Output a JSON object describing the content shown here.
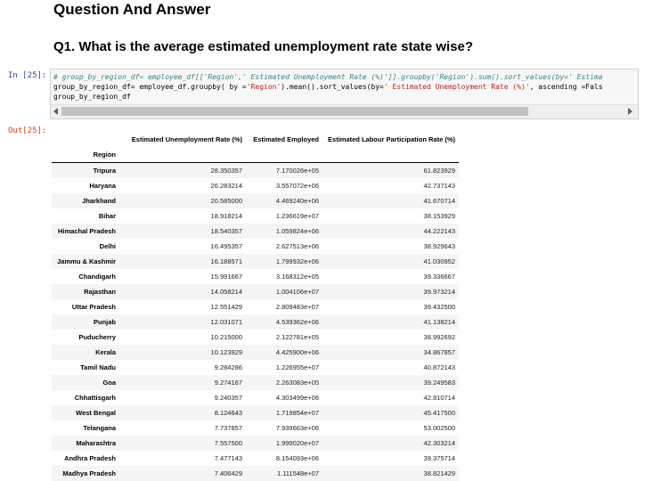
{
  "heading": "Question And Answer",
  "question": "Q1. What is the average estimated unemployment rate state wise?",
  "input_prompt": "In [25]:",
  "output_prompt": "Out[25]:",
  "code": {
    "line1": "# group_by_region_df= employee_df[['Region',' Estimated Unemployment Rate (%)']].groupby('Region').sum().sort_values(by=' Estima",
    "line2_pre": "group_by_region_df= employee_df.groupby( by =",
    "line2_s1": "'Region'",
    "line2_mid": ").mean().sort_values(by=",
    "line2_s2": "' Estimated Unemployment Rate (%)'",
    "line2_post": ", ascending =Fals",
    "line3": "group_by_region_df"
  },
  "table": {
    "columns": [
      "Estimated Unemployment Rate (%)",
      "Estimated Employed",
      "Estimated Labour Participation Rate (%)"
    ],
    "index_name": "Region",
    "rows": [
      {
        "region": "Tripura",
        "unemp": "28.350357",
        "employed": "7.170026e+05",
        "labour": "61.823929"
      },
      {
        "region": "Haryana",
        "unemp": "26.283214",
        "employed": "3.557072e+06",
        "labour": "42.737143"
      },
      {
        "region": "Jharkhand",
        "unemp": "20.585000",
        "employed": "4.469240e+06",
        "labour": "41.670714"
      },
      {
        "region": "Bihar",
        "unemp": "18.918214",
        "employed": "1.236619e+07",
        "labour": "38.153929"
      },
      {
        "region": "Himachal Pradesh",
        "unemp": "18.540357",
        "employed": "1.059824e+06",
        "labour": "44.222143"
      },
      {
        "region": "Delhi",
        "unemp": "16.495357",
        "employed": "2.627513e+06",
        "labour": "38.929643"
      },
      {
        "region": "Jammu & Kashmir",
        "unemp": "16.188571",
        "employed": "1.799932e+06",
        "labour": "41.030952"
      },
      {
        "region": "Chandigarh",
        "unemp": "15.991667",
        "employed": "3.168312e+05",
        "labour": "39.336667"
      },
      {
        "region": "Rajasthan",
        "unemp": "14.058214",
        "employed": "1.004106e+07",
        "labour": "39.973214"
      },
      {
        "region": "Uttar Pradesh",
        "unemp": "12.551429",
        "employed": "2.809483e+07",
        "labour": "39.432500"
      },
      {
        "region": "Punjab",
        "unemp": "12.031071",
        "employed": "4.539362e+06",
        "labour": "41.138214"
      },
      {
        "region": "Puducherry",
        "unemp": "10.215000",
        "employed": "2.122781e+05",
        "labour": "38.992692"
      },
      {
        "region": "Kerala",
        "unemp": "10.123929",
        "employed": "4.425900e+06",
        "labour": "34.867857"
      },
      {
        "region": "Tamil Nadu",
        "unemp": "9.284286",
        "employed": "1.226955e+07",
        "labour": "40.872143"
      },
      {
        "region": "Goa",
        "unemp": "9.274167",
        "employed": "2.263083e+05",
        "labour": "39.249583"
      },
      {
        "region": "Chhattisgarh",
        "unemp": "9.240357",
        "employed": "4.303499e+06",
        "labour": "42.810714"
      },
      {
        "region": "West Bengal",
        "unemp": "8.124643",
        "employed": "1.719854e+07",
        "labour": "45.417500"
      },
      {
        "region": "Telangana",
        "unemp": "7.737857",
        "employed": "7.939663e+06",
        "labour": "53.002500"
      },
      {
        "region": "Maharashtra",
        "unemp": "7.557500",
        "employed": "1.999020e+07",
        "labour": "42.303214"
      },
      {
        "region": "Andhra Pradesh",
        "unemp": "7.477143",
        "employed": "8.154093e+06",
        "labour": "39.375714"
      },
      {
        "region": "Madhya Pradesh",
        "unemp": "7.406429",
        "employed": "1.111548e+07",
        "labour": "38.821429"
      }
    ]
  }
}
